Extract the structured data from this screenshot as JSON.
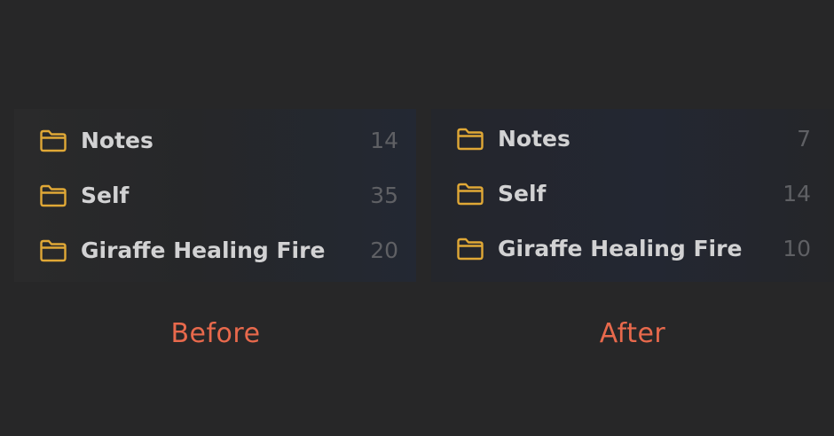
{
  "colors": {
    "background": "#272728",
    "folder_icon": "#e0a836",
    "label": "#d2d2d3",
    "count": "#5f6064",
    "caption": "#e8694c"
  },
  "before": {
    "caption": "Before",
    "folders": [
      {
        "icon": "folder-icon",
        "label": "Notes",
        "count": "14"
      },
      {
        "icon": "folder-icon",
        "label": "Self",
        "count": "35"
      },
      {
        "icon": "folder-icon",
        "label": "Giraffe Healing Fire",
        "count": "20"
      }
    ]
  },
  "after": {
    "caption": "After",
    "folders": [
      {
        "icon": "folder-icon",
        "label": "Notes",
        "count": "7"
      },
      {
        "icon": "folder-icon",
        "label": "Self",
        "count": "14"
      },
      {
        "icon": "folder-icon",
        "label": "Giraffe Healing Fire",
        "count": "10"
      }
    ]
  }
}
